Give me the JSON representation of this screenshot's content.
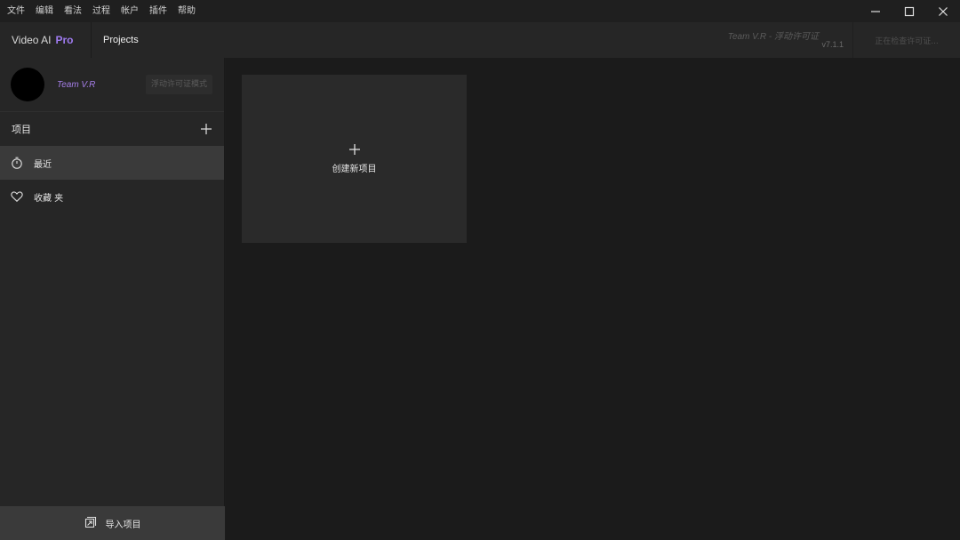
{
  "menubar": {
    "items": [
      "文件",
      "编辑",
      "看法",
      "过程",
      "帐户",
      "插件",
      "帮助"
    ]
  },
  "header": {
    "brand_name": "Video AI",
    "brand_tier": "Pro",
    "nav_projects": "Projects",
    "license_team": "Team V.R - 浮动许可证",
    "version": "v7.1.1",
    "license_status": "正在检查许可证..."
  },
  "sidebar": {
    "profile_name": "Team V.R",
    "license_mode": "浮动许可证模式",
    "section_title": "项目",
    "nav": [
      {
        "label": "最近",
        "icon": "timer-icon",
        "active": true
      },
      {
        "label": "收藏 夹",
        "icon": "heart-icon",
        "active": false
      }
    ],
    "import_label": "导入项目"
  },
  "main": {
    "new_project_label": "创建新项目"
  },
  "colors": {
    "accent": "#9f7bf0",
    "profile_name": "#a57ee8",
    "background": "#1b1b1b",
    "sidebar": "#262626",
    "active_item": "#3a3a3a"
  }
}
